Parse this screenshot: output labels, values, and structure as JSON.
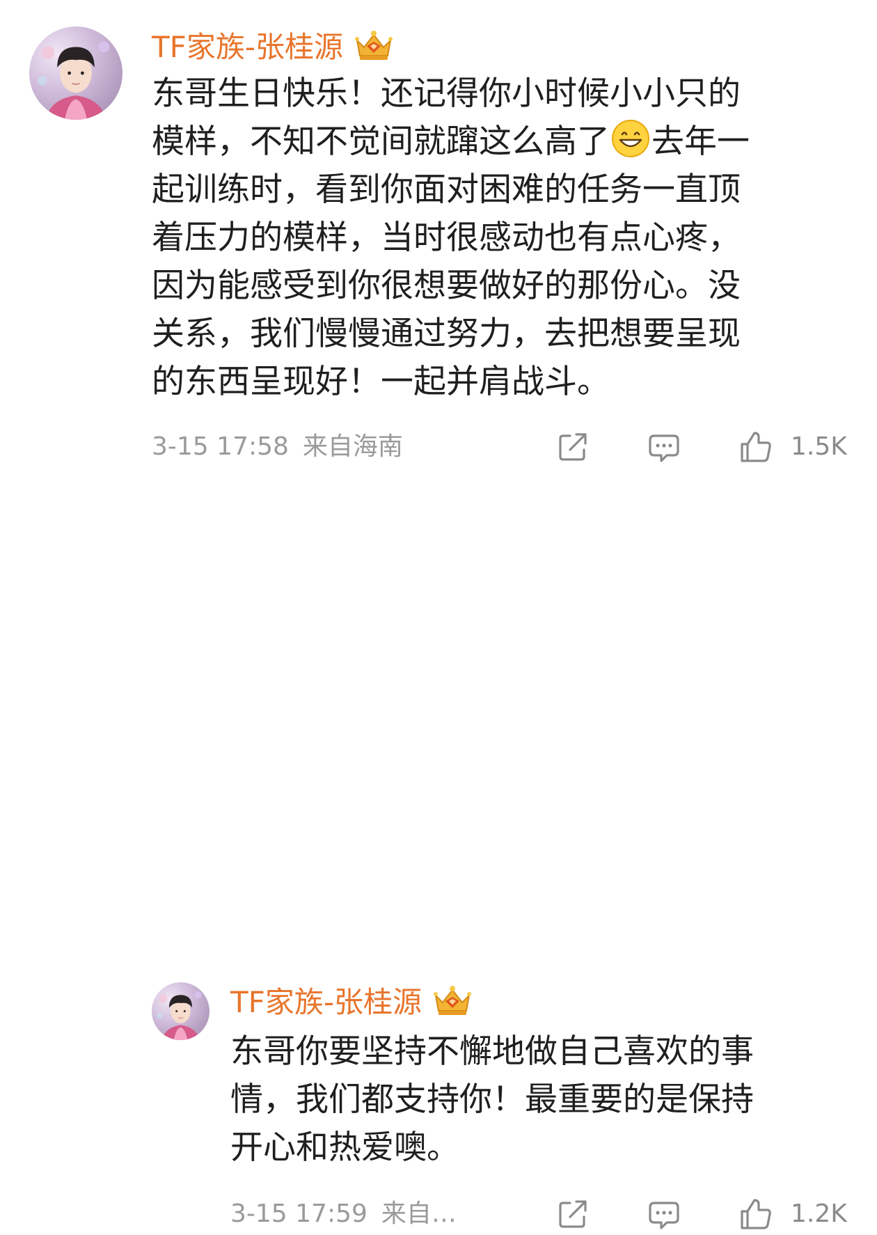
{
  "comments": [
    {
      "username": "TF家族-张桂源",
      "badge_icon": "crown-badge-icon",
      "lines": [
        "东哥生日快乐！还记得你小时候小小只的",
        [
          "模样，不知不觉间就蹿这么高了",
          "去年一"
        ],
        "起训练时，看到你面对困难的任务一直顶",
        "着压力的模样，当时很感动也有点心疼，",
        "因为能感受到你很想要做好的那份心。没",
        "关系，我们慢慢通过努力，去把想要呈现",
        "的东西呈现好！一起并肩战斗。"
      ],
      "emoji": "grinning-face-emoji",
      "time": "3-15 17:58",
      "location": "来自海南",
      "likes": "1.5K"
    },
    {
      "username": "TF家族-张桂源",
      "badge_icon": "crown-badge-icon",
      "lines": [
        "东哥你要坚持不懈地做自己喜欢的事",
        "情，我们都支持你！最重要的是保持",
        "开心和热爱噢。"
      ],
      "time": "3-15 17:59",
      "location": "来自…",
      "likes": "1.2K"
    }
  ],
  "icons": {
    "share": "share-icon",
    "comment": "comment-icon",
    "like": "thumbs-up-icon"
  },
  "colors": {
    "username": "#e8752c",
    "body_text": "#1f1f1f",
    "meta_text": "#9a9a9a",
    "icon_stroke": "#8a8a8a"
  }
}
